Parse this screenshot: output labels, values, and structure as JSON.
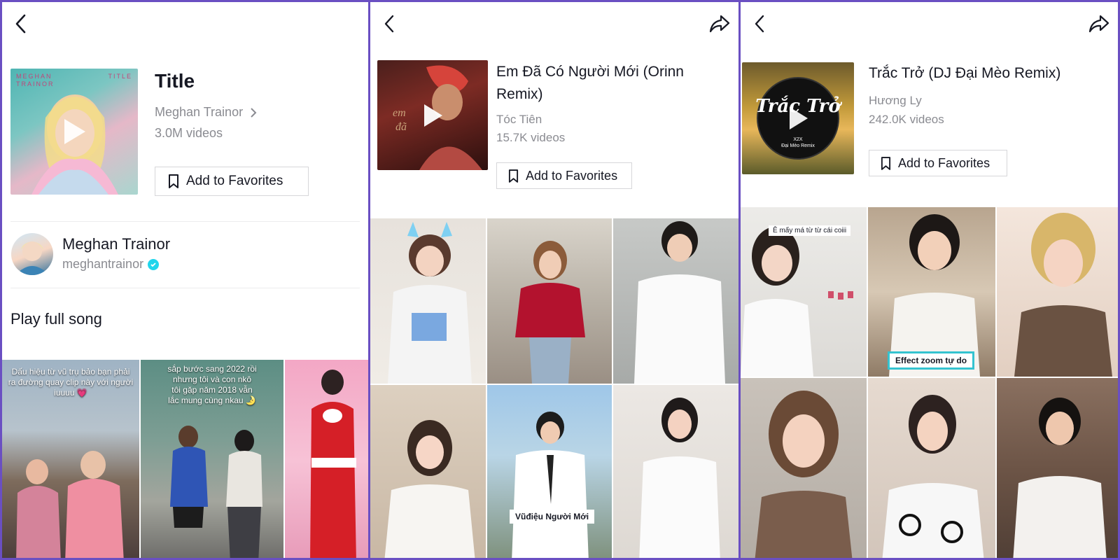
{
  "panels": [
    {
      "title": "Title",
      "artist": "Meghan Trainor",
      "video_count": "3.0M videos",
      "favorites_label": "Add to Favorites",
      "cover_text_left": "MEGHAN\nTRAINOR",
      "cover_text_right": "TITLE",
      "creator": {
        "name": "Meghan Trainor",
        "handle": "meghantrainor"
      },
      "play_full_song": "Play full song",
      "grid_captions": [
        "Dấu hiệu từ vũ trụ bảo bạn phải ra đường quay clip này với người iuuuu 💗",
        "sắp bước sang 2022 rồi nhưng tôi và con nkô tôi gặp năm 2018 vẫn lắc mung cùng nkau 🌛",
        ""
      ]
    },
    {
      "title": "Em Đã Có Người Mới (Orinn Remix)",
      "artist": "Tóc Tiên",
      "video_count": "15.7K videos",
      "favorites_label": "Add to Favorites",
      "grid_captions": [
        "",
        "",
        "",
        "",
        "Vũđiệu Người Mới",
        ""
      ]
    },
    {
      "title": "Trắc Trở (DJ Đại Mèo Remix)",
      "artist": "Hương Ly",
      "video_count": "242.0K videos",
      "favorites_label": "Add to Favorites",
      "cover_text": "Trắc Trở",
      "cover_subtext": "X2X\nĐại Mèo Remix",
      "grid_captions": [
        "Ê mấy má từ từ cái coiii",
        "Effect zoom tự do",
        "",
        "",
        "",
        ""
      ]
    }
  ],
  "colors": {
    "frame_border": "#6a4fc2",
    "verified": "#20d5ec",
    "text_primary": "#161823",
    "text_secondary": "#8a8b91"
  },
  "icons": [
    "chevron-left-icon",
    "share-icon",
    "bookmark-icon",
    "play-icon",
    "chevron-right-icon",
    "verified-icon"
  ]
}
